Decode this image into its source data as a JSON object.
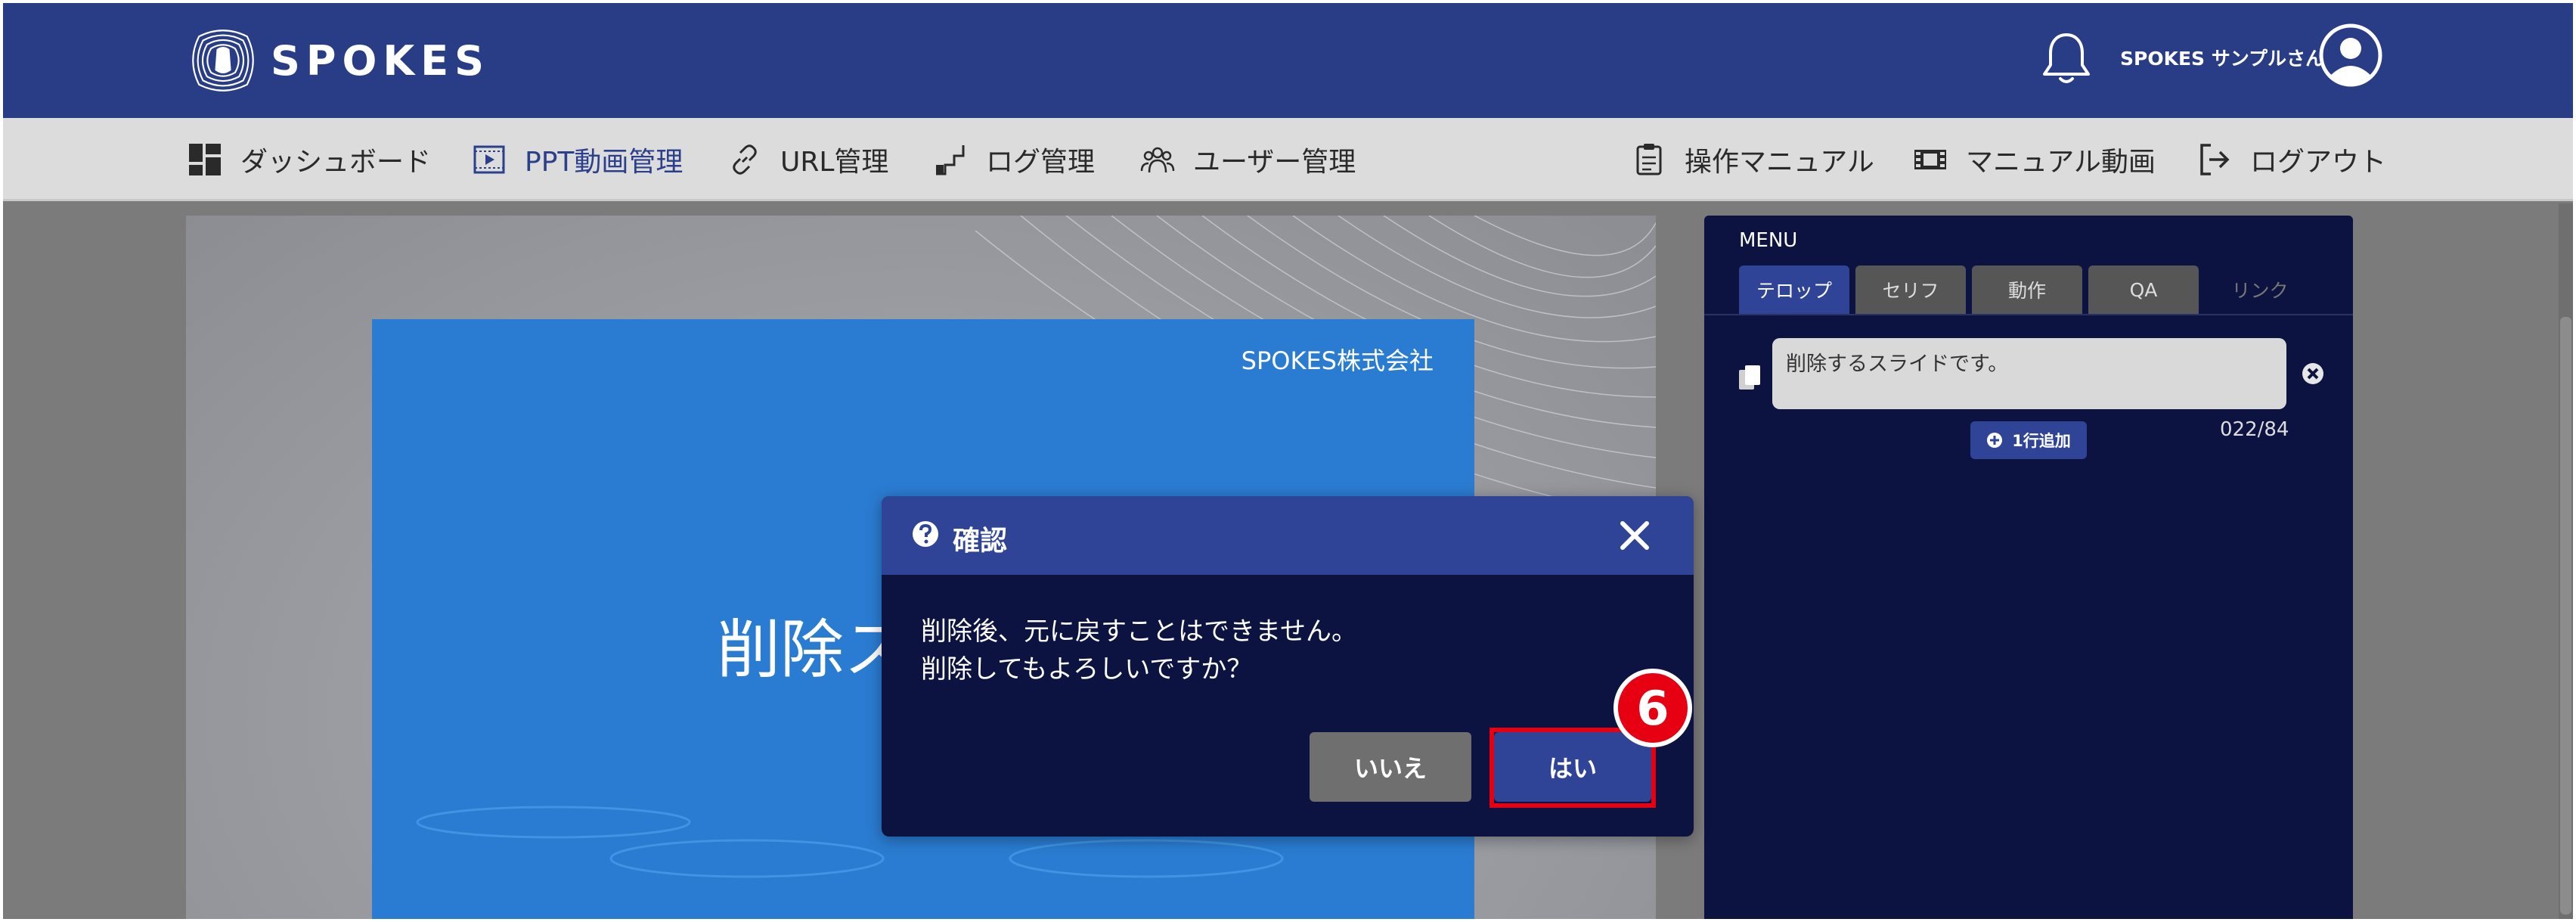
{
  "header": {
    "logo_text": "SPOKES",
    "user_name": "SPOKES サンプルさん",
    "icons": [
      "bell-icon",
      "account-icon"
    ]
  },
  "nav": {
    "dashboard": "ダッシュボード",
    "ppt_video": "PPT動画管理",
    "url": "URL管理",
    "log": "ログ管理",
    "user": "ユーザー管理",
    "manual": "操作マニュアル",
    "manual_video": "マニュアル動画",
    "logout": "ログアウト"
  },
  "slide": {
    "company": "SPOKES株式会社",
    "title_visible": "削除ス"
  },
  "menu": {
    "title": "MENU",
    "tabs": [
      "テロップ",
      "セリフ",
      "動作",
      "QA",
      "リンク"
    ],
    "active_tab": "テロップ",
    "telop_text": "削除するスライドです。",
    "add_line": "1行追加",
    "char_count": "022/84"
  },
  "dialog": {
    "title": "確認",
    "message_line1": "削除後、元に戻すことはできません。",
    "message_line2": "削除してもよろしいですか？",
    "no_label": "いいえ",
    "yes_label": "はい"
  },
  "annotation": {
    "step": "6"
  },
  "colors": {
    "header_bg": "#283d86",
    "nav_bg": "#dcdcdc",
    "panel_bg": "#0c1340",
    "accent": "#2f4497",
    "slide_blue": "#2a7cd2",
    "highlight": "#e60012"
  }
}
